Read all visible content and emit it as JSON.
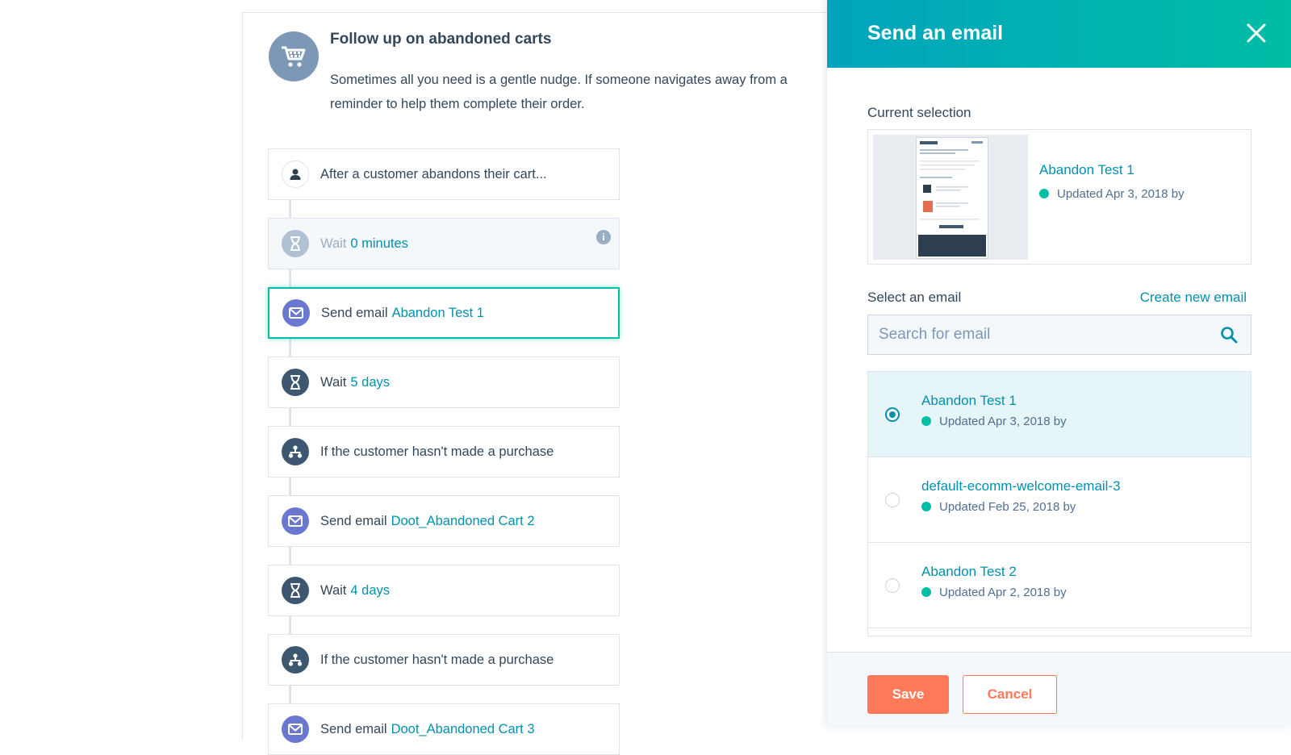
{
  "workflow": {
    "title": "Follow up on abandoned carts",
    "description": "Sometimes all you need is a gentle nudge. If someone navigates away from a reminder to help them complete their order.",
    "steps": [
      {
        "prefix": "After a customer abandons their cart...",
        "link": "",
        "icon": "person-icon"
      },
      {
        "prefix": "Wait",
        "link": "0 minutes",
        "icon": "hourglass-icon"
      },
      {
        "prefix": "Send email",
        "link": "Abandon Test 1",
        "icon": "envelope-icon"
      },
      {
        "prefix": "Wait",
        "link": "5 days",
        "icon": "hourglass-icon"
      },
      {
        "prefix": "If the customer hasn't made a purchase",
        "link": "",
        "icon": "branch-icon"
      },
      {
        "prefix": "Send email",
        "link": "Doot_Abandoned Cart 2",
        "icon": "envelope-icon"
      },
      {
        "prefix": "Wait",
        "link": "4 days",
        "icon": "hourglass-icon"
      },
      {
        "prefix": "If the customer hasn't made a purchase",
        "link": "",
        "icon": "branch-icon"
      },
      {
        "prefix": "Send email",
        "link": "Doot_Abandoned Cart 3",
        "icon": "envelope-icon"
      }
    ]
  },
  "panel": {
    "title": "Send an email",
    "current_selection_label": "Current selection",
    "current": {
      "name": "Abandon Test 1",
      "updated": "Updated Apr 3, 2018 by"
    },
    "select_label": "Select an email",
    "create_link": "Create new email",
    "search_placeholder": "Search for email",
    "emails": [
      {
        "name": "Abandon Test 1",
        "updated": "Updated Apr 3, 2018 by",
        "selected": true
      },
      {
        "name": "default-ecomm-welcome-email-3",
        "updated": "Updated Feb 25, 2018 by",
        "selected": false
      },
      {
        "name": "Abandon Test 2",
        "updated": "Updated Apr 2, 2018 by",
        "selected": false
      }
    ],
    "save_label": "Save",
    "cancel_label": "Cancel"
  },
  "colors": {
    "accent": "#00bda5",
    "link": "#0091ae",
    "primary_button": "#ff7a59",
    "header_gradient_start": "#00a4bd"
  }
}
